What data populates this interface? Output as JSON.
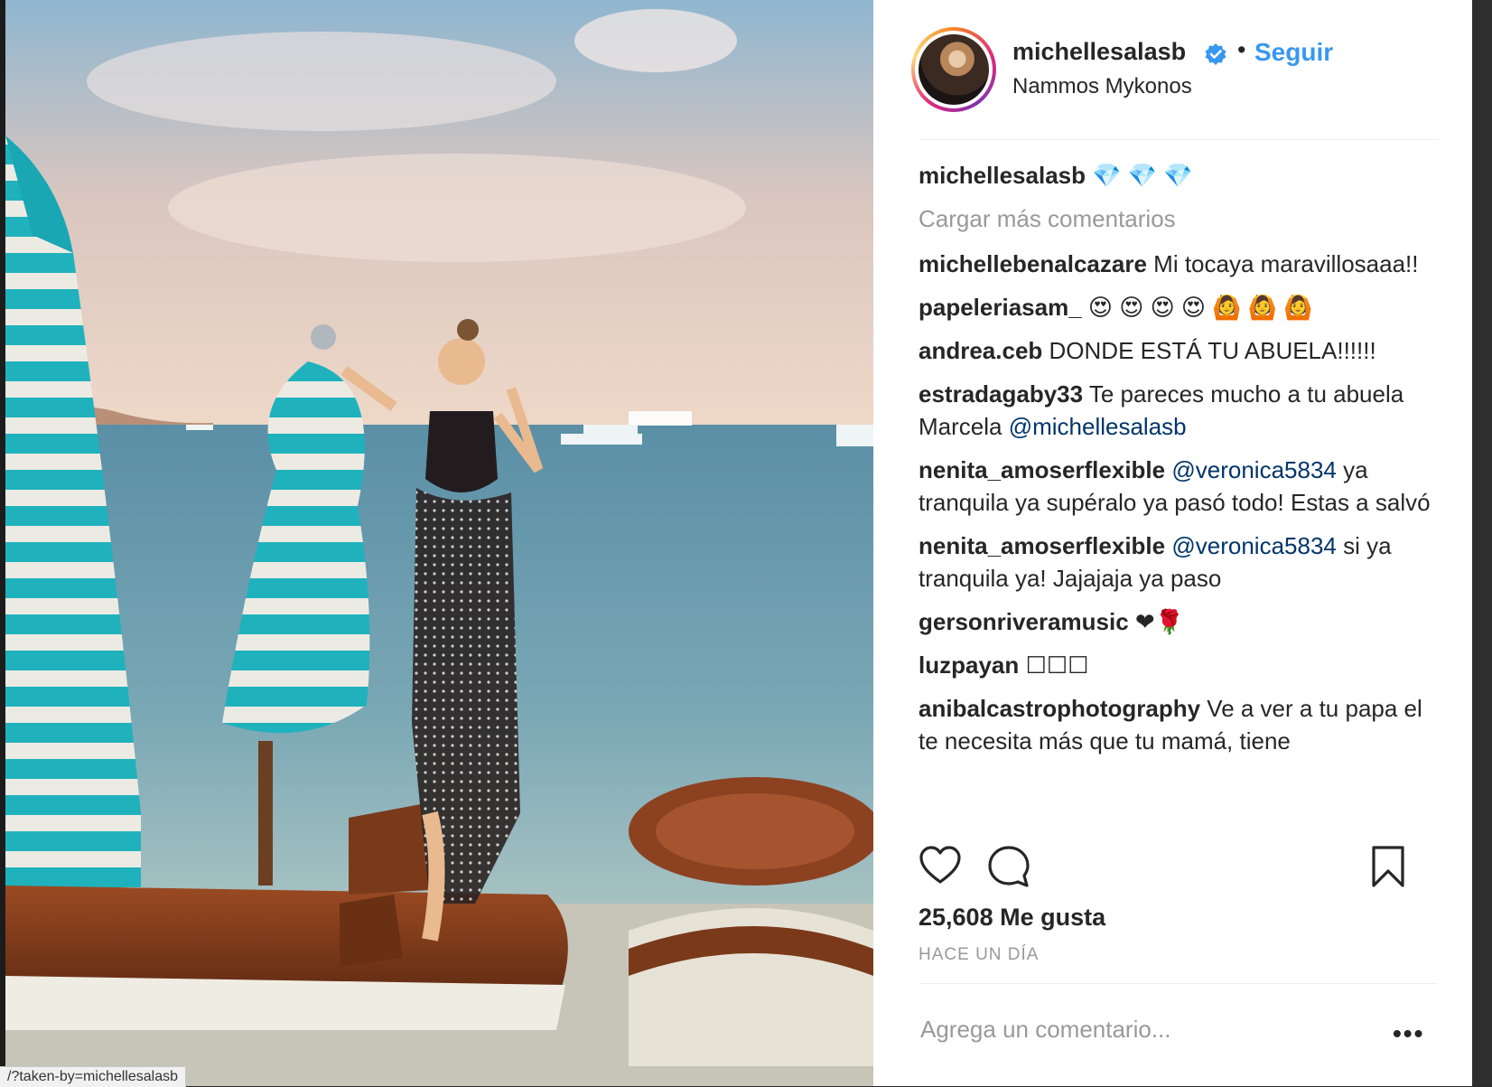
{
  "post": {
    "username": "michellesalasb",
    "follow_label": "Seguir",
    "separator": "•",
    "location": "Nammos Mykonos",
    "caption": {
      "user": "michellesalasb",
      "text": "💎 💎 💎"
    },
    "load_more": "Cargar más comentarios",
    "comments": [
      {
        "user": "michellebenalcazare",
        "text": "Mi tocaya maravillosaaa!!",
        "mention": ""
      },
      {
        "user": "papeleriasam_",
        "text": "😍 😍 😍 😍 🙆 🙆 🙆",
        "mention": ""
      },
      {
        "user": "andrea.ceb",
        "text": "DONDE ESTÁ TU ABUELA!!!!!!",
        "mention": ""
      },
      {
        "user": "estradagaby33",
        "text": "Te pareces mucho a tu abuela Marcela ",
        "mention": "@michellesalasb"
      },
      {
        "user": "nenita_amoserflexible",
        "mention_before": "@veronica5834",
        "text": " ya tranquila ya supéralo ya pasó todo! Estas a salvó"
      },
      {
        "user": "nenita_amoserflexible",
        "mention_before": "@veronica5834",
        "text": " si ya tranquila ya! Jajajaja ya paso"
      },
      {
        "user": "gersonriveramusic",
        "text": "❤🌹",
        "mention": ""
      },
      {
        "user": "luzpayan",
        "text": "☐☐☐",
        "mention": ""
      },
      {
        "user": "anibalcastrophotography",
        "text": "Ve a ver a tu papa el te necesita más que tu mamá, tiene",
        "mention": ""
      }
    ],
    "likes": "25,608 Me gusta",
    "time": "HACE UN DÍA",
    "comment_placeholder": "Agrega un comentario...",
    "more_options": "•••"
  },
  "status_bar": {
    "url": "/?taken-by=michellesalasb"
  },
  "icons": {
    "verified": "verified-badge-icon",
    "like": "heart-icon",
    "comment": "comment-bubble-icon",
    "save": "bookmark-icon"
  },
  "colors": {
    "follow": "#3897f0",
    "mention": "#003569",
    "muted": "#999999",
    "verified": "#3897f0"
  }
}
